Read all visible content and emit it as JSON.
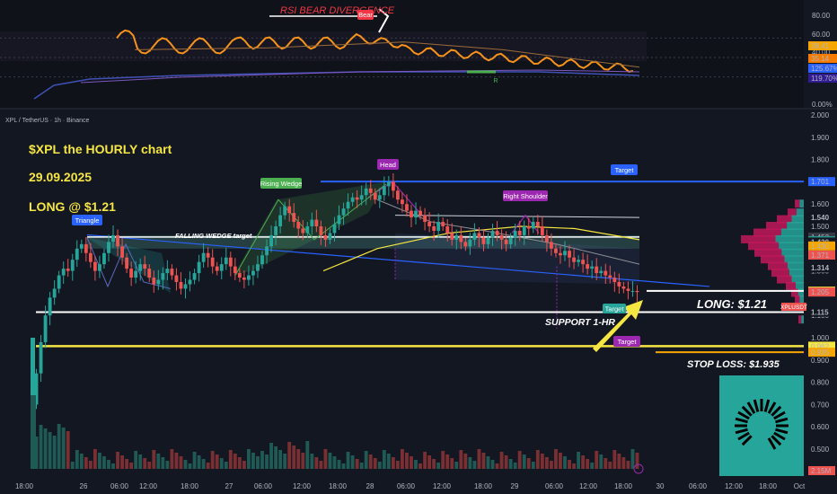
{
  "header": {
    "symbol_line": "XPL / TetherUS · 1h · Binance"
  },
  "annotations": {
    "title_1": "$XPL   the HOURLY chart",
    "title_2": "29.09.2025",
    "title_3": "LONG @ $1.21",
    "rsi_div": "RSI BEAR DIVERGENCE",
    "bear": "Bear",
    "r_label": "R",
    "falling_wedge": "FALLING WEDGE target",
    "rising_wedge": "Rising Wedge",
    "head": "Head",
    "right_shoulder": "Right Shoulder",
    "triangle": "Triangle",
    "target_1": "Target",
    "target_2": "Target",
    "target_3": "Target",
    "long": "LONG: $1.21",
    "support": "SUPPORT 1-HR",
    "stop_loss": "STOP LOSS: $1.935"
  },
  "price_axis": {
    "ticks": [
      "2.000",
      "1.900",
      "1.800",
      "1.700",
      "1.600",
      "1.500",
      "1.400",
      "1.300",
      "1.200",
      "1.100",
      "1.000",
      "0.900",
      "0.800",
      "0.700",
      "0.600",
      "0.500"
    ],
    "badges": [
      {
        "label": "1.701",
        "color": "#2962ff",
        "value": 1.701
      },
      {
        "label": "1.540",
        "color": "#131722",
        "value": 1.54
      },
      {
        "label": "1.452",
        "color": "#363a45",
        "value": 1.452
      },
      {
        "label": "1.435",
        "color": "#26a69a",
        "value": 1.435
      },
      {
        "label": "1.430",
        "color": "#131722",
        "value": 1.43
      },
      {
        "label": "1.430",
        "color": "#f7a600",
        "value": 1.412
      },
      {
        "label": "1.371",
        "color": "#ef5350",
        "value": 1.371
      },
      {
        "label": "1.314",
        "color": "#131722",
        "value": 1.314
      },
      {
        "label": "1.209",
        "color": "#f5e642",
        "value": 1.209
      },
      {
        "label": "1.205",
        "color": "#ef5350",
        "value": 1.205
      },
      {
        "label": "1.115",
        "color": "#131722",
        "value": 1.115
      },
      {
        "label": "0.962",
        "color": "#f5e642",
        "value": 0.962
      },
      {
        "label": "0.935",
        "color": "#f7a600",
        "value": 0.935
      },
      {
        "label": "2.15M",
        "color": "#ef5350",
        "value": 2.15
      }
    ],
    "symbol_tag": "XPLUSDT"
  },
  "rsi_axis": {
    "ticks": [
      "80.00",
      "60.00",
      "40.00",
      "0.00%"
    ],
    "badges": [
      {
        "label": "38.41",
        "color": "#f7a600"
      },
      {
        "label": "35.14",
        "color": "#f57c00"
      },
      {
        "label": "125.67%",
        "color": "#2962ff"
      },
      {
        "label": "119.70%",
        "color": "#311b92"
      }
    ]
  },
  "time_axis": [
    "18:00",
    "26",
    "06:00",
    "12:00",
    "18:00",
    "27",
    "06:00",
    "12:00",
    "18:00",
    "28",
    "06:00",
    "12:00",
    "18:00",
    "29",
    "06:00",
    "12:00",
    "18:00",
    "30",
    "06:00",
    "12:00",
    "18:00",
    "Oct"
  ],
  "chart_data": {
    "type": "candlestick",
    "symbol": "XPL / TetherUS",
    "interval": "1h",
    "exchange": "Binance",
    "ylim": [
      0.45,
      2.0
    ],
    "close": [
      0.84,
      0.98,
      1.1,
      1.18,
      1.22,
      1.28,
      1.31,
      1.3,
      1.35,
      1.4,
      1.42,
      1.38,
      1.34,
      1.3,
      1.33,
      1.38,
      1.43,
      1.46,
      1.41,
      1.36,
      1.31,
      1.27,
      1.3,
      1.33,
      1.31,
      1.27,
      1.24,
      1.26,
      1.29,
      1.31,
      1.28,
      1.25,
      1.22,
      1.24,
      1.26,
      1.29,
      1.34,
      1.38,
      1.36,
      1.32,
      1.3,
      1.33,
      1.36,
      1.32,
      1.29,
      1.27,
      1.26,
      1.28,
      1.3,
      1.33,
      1.37,
      1.41,
      1.46,
      1.5,
      1.55,
      1.59,
      1.56,
      1.52,
      1.49,
      1.47,
      1.5,
      1.53,
      1.5,
      1.46,
      1.44,
      1.47,
      1.51,
      1.55,
      1.58,
      1.61,
      1.63,
      1.62,
      1.64,
      1.67,
      1.65,
      1.62,
      1.64,
      1.68,
      1.7,
      1.66,
      1.62,
      1.6,
      1.57,
      1.54,
      1.57,
      1.55,
      1.52,
      1.5,
      1.48,
      1.52,
      1.5,
      1.47,
      1.44,
      1.46,
      1.43,
      1.41,
      1.44,
      1.47,
      1.45,
      1.42,
      1.45,
      1.48,
      1.46,
      1.44,
      1.42,
      1.45,
      1.48,
      1.46,
      1.5,
      1.49,
      1.52,
      1.5,
      1.46,
      1.43,
      1.4,
      1.38,
      1.37,
      1.39,
      1.36,
      1.34,
      1.35,
      1.33,
      1.31,
      1.32,
      1.29,
      1.3,
      1.28,
      1.27,
      1.25,
      1.23,
      1.22,
      1.21,
      1.21,
      1.205
    ],
    "volume_last": "2.15M",
    "levels": {
      "target_top": 1.701,
      "falling_wedge_target": 1.452,
      "long_entry": 1.21,
      "support_1hr": 1.115,
      "support_low": 0.962,
      "stop_loss_label": 1.935
    },
    "rsi": {
      "ylim": [
        0,
        100
      ],
      "last": 38.41,
      "signal": 35.14
    }
  }
}
